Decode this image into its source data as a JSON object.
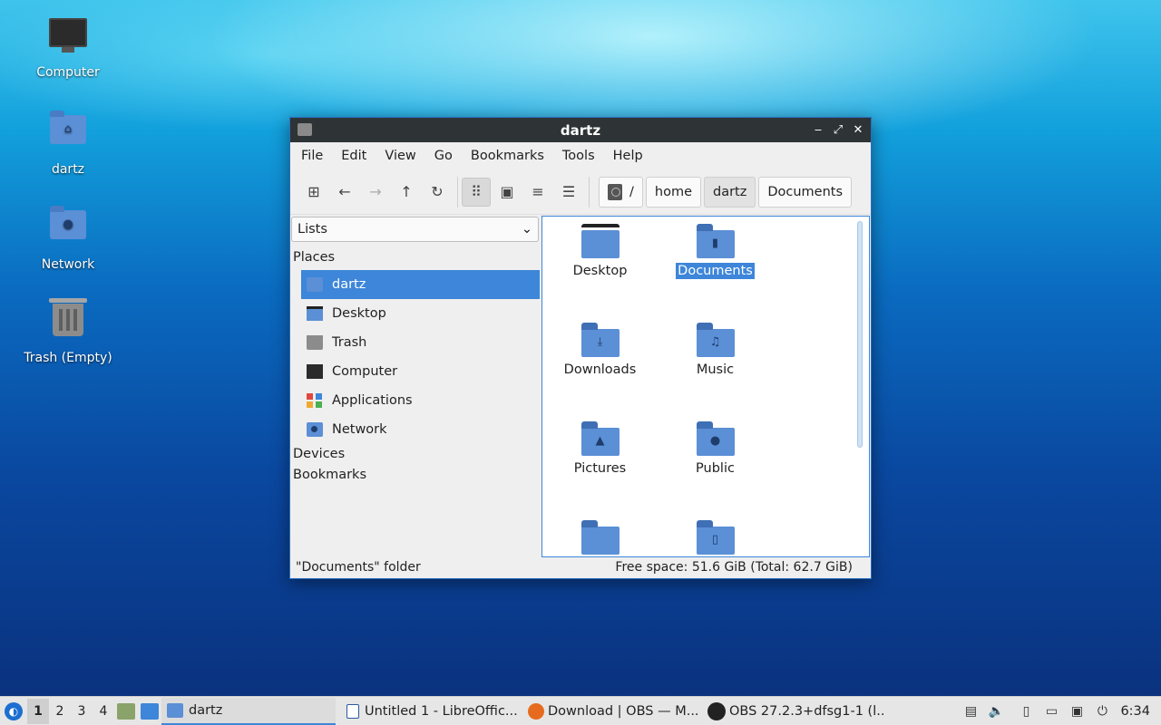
{
  "desktop": {
    "icons": [
      {
        "label": "Computer",
        "icon": "computer-icon"
      },
      {
        "label": "dartz",
        "icon": "home-folder-icon"
      },
      {
        "label": "Network",
        "icon": "network-folder-icon"
      },
      {
        "label": "Trash (Empty)",
        "icon": "trash-icon"
      }
    ]
  },
  "window": {
    "title": "dartz",
    "controls": {
      "minimize": "‒",
      "maximize": "⤢",
      "close": "✕"
    },
    "menu": [
      "File",
      "Edit",
      "View",
      "Go",
      "Bookmarks",
      "Tools",
      "Help"
    ],
    "toolbar": {
      "new_tab": "⊞",
      "back": "←",
      "forward": "→",
      "up": "↑",
      "reload": "↻",
      "view_icons": "⠿",
      "view_thumbnails": "▣",
      "view_compact": "≡",
      "view_details": "☰"
    },
    "path": [
      "/",
      "home",
      "dartz",
      "Documents"
    ],
    "sidebar": {
      "mode": "Lists",
      "places_heading": "Places",
      "places": [
        "dartz",
        "Desktop",
        "Trash",
        "Computer",
        "Applications",
        "Network"
      ],
      "devices_heading": "Devices",
      "bookmarks_heading": "Bookmarks"
    },
    "files": [
      "Desktop",
      "Documents",
      "Downloads",
      "Music",
      "Pictures",
      "Public",
      "",
      ""
    ],
    "selected_file": "Documents",
    "status_left": "\"Documents\" folder",
    "status_right": "Free space: 51.6 GiB (Total: 62.7 GiB)"
  },
  "taskbar": {
    "workspaces": [
      "1",
      "2",
      "3",
      "4"
    ],
    "tasks": [
      {
        "label": "dartz",
        "icon": "folder-icon"
      },
      {
        "label": "Untitled 1 - LibreOffic...",
        "icon": "libreoffice-writer-icon"
      },
      {
        "label": "Download | OBS — M...",
        "icon": "firefox-icon"
      },
      {
        "label": "OBS 27.2.3+dfsg1-1 (l...",
        "icon": "obs-icon"
      }
    ],
    "clock": "6:34"
  },
  "colors": {
    "accent": "#3d86d9",
    "folder": "#5b8fd6",
    "titlebar": "#2e3436"
  }
}
